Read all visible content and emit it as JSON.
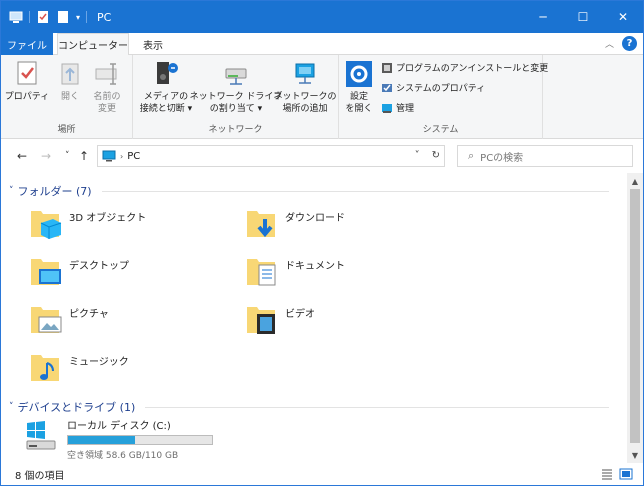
{
  "window": {
    "title": "PC",
    "controls": {
      "minimize": "─",
      "maximize": "☐",
      "close": "✕"
    }
  },
  "ribbon_tabs": {
    "file": "ファイル",
    "computer": "コンピューター",
    "view": "表示"
  },
  "ribbon": {
    "location": {
      "label": "場所",
      "properties": "プロパティ",
      "open": "開く",
      "rename_1": "名前の",
      "rename_2": "変更"
    },
    "network": {
      "label": "ネットワーク",
      "media_1": "メディアの",
      "media_2": "接続と切断",
      "map_drive_1": "ネットワーク ドライブ",
      "map_drive_2": "の割り当て",
      "add_location_1": "ネットワークの",
      "add_location_2": "場所の追加"
    },
    "system": {
      "label": "システム",
      "settings_1": "設定",
      "settings_2": "を開く",
      "uninstall": "プログラムのアンインストールと変更",
      "system_properties": "システムのプロパティ",
      "manage": "管理"
    }
  },
  "address": {
    "path": "PC",
    "search_placeholder": "PCの検索"
  },
  "sections": {
    "folders": "フォルダー (7)",
    "devices": "デバイスとドライブ (1)"
  },
  "folders": [
    {
      "name": "3D オブジェクト",
      "icon": "3d-objects-folder-icon"
    },
    {
      "name": "ダウンロード",
      "icon": "downloads-folder-icon"
    },
    {
      "name": "デスクトップ",
      "icon": "desktop-folder-icon"
    },
    {
      "name": "ドキュメント",
      "icon": "documents-folder-icon"
    },
    {
      "name": "ピクチャ",
      "icon": "pictures-folder-icon"
    },
    {
      "name": "ビデオ",
      "icon": "videos-folder-icon"
    },
    {
      "name": "ミュージック",
      "icon": "music-folder-icon"
    }
  ],
  "drive": {
    "name": "ローカル ディスク (C:)",
    "free_text": "空き領域 58.6 GB/110 GB",
    "used_fraction": 0.467
  },
  "status": {
    "item_count": "8 個の項目"
  },
  "colors": {
    "accent": "#1a73d2",
    "folder": "#f8d775",
    "drive_bar": "#26a0da",
    "section_text": "#1e3f8e"
  }
}
